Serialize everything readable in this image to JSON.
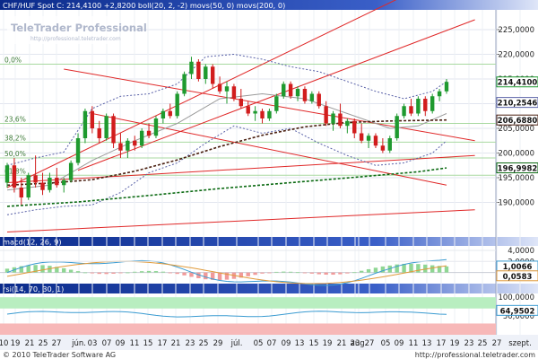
{
  "colors": {
    "up": "#1f9a2f",
    "down": "#d11d1d",
    "ma50": "#4a1f10",
    "ma200": "#0b6a12",
    "boll": "#5a62a8",
    "trend": "#e02828",
    "fib": "#a8d9a0",
    "macd_line": "#3a9bd1",
    "macd_signal": "#e09a3a",
    "rsi_line": "#3a9bd1",
    "rsi_over": "#f7b8b8",
    "rsi_under": "#b8eec0",
    "header_bg": "#0a2a8a",
    "sep": "#8aa0d8"
  },
  "chart_data": [
    {
      "type": "candlestick",
      "title": "CHF/HUF Spot C: 214,4100 +2,8200 boll(20, 2, -2) movs(50, 0) movs(200, 0)",
      "ylim": [
        183,
        229
      ],
      "yticks": [
        "225,0000",
        "220,0000",
        "215,0000",
        "210,0000",
        "205,0000",
        "200,0000",
        "195,0000",
        "190,0000"
      ],
      "fib_levels": [
        {
          "label": "0,0%",
          "value": 218.0
        },
        {
          "label": "23,6%",
          "value": 206.0
        },
        {
          "label": "38,2%",
          "value": 202.2
        },
        {
          "label": "50,0%",
          "value": 199.0
        },
        {
          "label": "61,8%",
          "value": 195.5
        }
      ],
      "price_tags": [
        {
          "text": "214,4100",
          "value": 214.41,
          "color": "#1f9a2f"
        },
        {
          "text": "210,2546",
          "value": 210.25,
          "color": "#5a62a8"
        },
        {
          "text": "206,6880",
          "value": 206.69,
          "color": "#4a1f10"
        },
        {
          "text": "196,9982",
          "value": 196.99,
          "color": "#0b6a12"
        }
      ],
      "candles": [
        [
          194.0,
          198.0,
          193.0,
          197.5
        ],
        [
          197.5,
          199.0,
          192.0,
          193.0
        ],
        [
          193.0,
          195.0,
          189.5,
          191.0
        ],
        [
          191.0,
          196.0,
          190.5,
          195.5
        ],
        [
          195.5,
          199.5,
          193.0,
          194.0
        ],
        [
          194.0,
          196.0,
          191.5,
          192.5
        ],
        [
          192.5,
          196.0,
          192.0,
          195.0
        ],
        [
          195.0,
          197.0,
          193.0,
          193.5
        ],
        [
          193.5,
          195.0,
          192.0,
          194.5
        ],
        [
          194.5,
          198.5,
          194.0,
          198.0
        ],
        [
          198.0,
          204.0,
          197.5,
          203.0
        ],
        [
          203.0,
          209.0,
          202.0,
          208.5
        ],
        [
          208.5,
          209.5,
          204.0,
          205.0
        ],
        [
          205.0,
          206.5,
          202.0,
          203.0
        ],
        [
          203.0,
          208.0,
          202.5,
          207.5
        ],
        [
          207.5,
          208.0,
          201.0,
          202.0
        ],
        [
          202.0,
          204.0,
          199.0,
          200.5
        ],
        [
          200.5,
          203.0,
          199.0,
          202.5
        ],
        [
          202.5,
          203.5,
          200.5,
          201.5
        ],
        [
          201.5,
          205.0,
          201.0,
          204.5
        ],
        [
          204.5,
          206.0,
          203.0,
          203.5
        ],
        [
          203.5,
          207.5,
          203.0,
          207.0
        ],
        [
          207.0,
          209.0,
          206.0,
          208.5
        ],
        [
          208.5,
          210.0,
          207.0,
          207.5
        ],
        [
          207.5,
          212.5,
          207.0,
          212.0
        ],
        [
          212.0,
          216.5,
          211.5,
          216.0
        ],
        [
          216.0,
          219.5,
          215.0,
          218.5
        ],
        [
          218.5,
          219.0,
          214.5,
          215.0
        ],
        [
          215.0,
          218.0,
          214.0,
          217.5
        ],
        [
          217.5,
          218.0,
          213.0,
          214.0
        ],
        [
          214.0,
          215.5,
          212.0,
          212.5
        ],
        [
          212.5,
          214.5,
          210.0,
          213.5
        ],
        [
          213.5,
          214.0,
          210.5,
          211.0
        ],
        [
          211.0,
          213.0,
          209.0,
          209.5
        ],
        [
          209.5,
          210.5,
          207.5,
          208.0
        ],
        [
          208.0,
          209.5,
          206.5,
          208.5
        ],
        [
          208.5,
          209.0,
          206.0,
          207.0
        ],
        [
          207.0,
          209.0,
          206.5,
          208.5
        ],
        [
          208.5,
          212.0,
          208.0,
          211.5
        ],
        [
          211.5,
          214.5,
          211.0,
          214.0
        ],
        [
          214.0,
          214.5,
          211.0,
          211.5
        ],
        [
          211.5,
          213.5,
          210.5,
          213.0
        ],
        [
          213.0,
          213.5,
          210.0,
          210.5
        ],
        [
          210.5,
          212.5,
          210.0,
          212.0
        ],
        [
          212.0,
          212.5,
          209.0,
          209.5
        ],
        [
          209.5,
          210.5,
          205.5,
          206.0
        ],
        [
          206.0,
          208.5,
          204.5,
          208.0
        ],
        [
          208.0,
          210.0,
          205.0,
          205.5
        ],
        [
          205.5,
          207.0,
          204.0,
          206.5
        ],
        [
          206.5,
          207.0,
          203.0,
          204.0
        ],
        [
          204.0,
          206.0,
          202.0,
          202.5
        ],
        [
          202.5,
          204.0,
          201.0,
          203.5
        ],
        [
          203.5,
          204.0,
          201.0,
          201.5
        ],
        [
          201.5,
          203.0,
          200.0,
          200.5
        ],
        [
          200.5,
          203.5,
          200.0,
          203.0
        ],
        [
          203.0,
          208.0,
          202.5,
          207.5
        ],
        [
          207.5,
          210.0,
          207.0,
          209.5
        ],
        [
          209.5,
          211.0,
          207.5,
          208.0
        ],
        [
          208.0,
          211.5,
          207.5,
          211.0
        ],
        [
          211.0,
          211.5,
          207.5,
          208.5
        ],
        [
          208.5,
          212.0,
          208.0,
          211.5
        ],
        [
          211.5,
          213.0,
          210.5,
          212.5
        ],
        [
          212.5,
          215.0,
          212.0,
          214.41
        ]
      ],
      "ma50": [
        [
          0,
          193.5
        ],
        [
          6,
          193.9
        ],
        [
          12,
          194.6
        ],
        [
          18,
          196.3
        ],
        [
          24,
          198.6
        ],
        [
          30,
          201.3
        ],
        [
          36,
          203.6
        ],
        [
          42,
          205.3
        ],
        [
          48,
          206.2
        ],
        [
          54,
          206.5
        ],
        [
          58,
          206.6
        ],
        [
          62,
          206.69
        ]
      ],
      "ma200": [
        [
          0,
          189.2
        ],
        [
          10,
          190.1
        ],
        [
          20,
          191.4
        ],
        [
          30,
          192.8
        ],
        [
          40,
          194.0
        ],
        [
          50,
          195.2
        ],
        [
          58,
          196.2
        ],
        [
          62,
          196.99
        ]
      ],
      "boll_upper": [
        [
          0,
          197.5
        ],
        [
          4,
          199.0
        ],
        [
          8,
          200.2
        ],
        [
          12,
          209.0
        ],
        [
          16,
          211.5
        ],
        [
          20,
          212.0
        ],
        [
          24,
          214.0
        ],
        [
          28,
          219.5
        ],
        [
          32,
          220.0
        ],
        [
          36,
          219.0
        ],
        [
          40,
          217.5
        ],
        [
          44,
          216.5
        ],
        [
          48,
          214.5
        ],
        [
          52,
          212.5
        ],
        [
          56,
          211.0
        ],
        [
          60,
          212.5
        ],
        [
          62,
          214.5
        ]
      ],
      "boll_lower": [
        [
          0,
          187.5
        ],
        [
          4,
          188.5
        ],
        [
          8,
          189.2
        ],
        [
          12,
          189.5
        ],
        [
          16,
          192.0
        ],
        [
          20,
          196.0
        ],
        [
          24,
          198.0
        ],
        [
          28,
          202.0
        ],
        [
          32,
          205.5
        ],
        [
          36,
          204.0
        ],
        [
          40,
          205.0
        ],
        [
          44,
          202.0
        ],
        [
          48,
          199.5
        ],
        [
          52,
          197.5
        ],
        [
          56,
          198.0
        ],
        [
          60,
          200.0
        ],
        [
          62,
          202.5
        ]
      ],
      "boll_mid": [
        [
          0,
          192.5
        ],
        [
          6,
          193.5
        ],
        [
          12,
          198.5
        ],
        [
          18,
          202.5
        ],
        [
          24,
          206.0
        ],
        [
          30,
          211.0
        ],
        [
          36,
          212.0
        ],
        [
          42,
          211.0
        ],
        [
          48,
          208.0
        ],
        [
          54,
          205.0
        ],
        [
          58,
          205.5
        ],
        [
          62,
          208.0
        ]
      ],
      "trendlines": [
        [
          [
            0,
            193.0
          ],
          [
            62,
            236.0
          ]
        ],
        [
          [
            10,
            196.5
          ],
          [
            66,
            227.0
          ]
        ],
        [
          [
            8,
            217.0
          ],
          [
            66,
            202.5
          ]
        ],
        [
          [
            12,
            208.0
          ],
          [
            62,
            193.5
          ]
        ],
        [
          [
            0,
            194.0
          ],
          [
            66,
            199.5
          ]
        ],
        [
          [
            0,
            184.0
          ],
          [
            66,
            188.5
          ]
        ]
      ]
    },
    {
      "type": "bar",
      "title": "macd(12, 26, 9)",
      "ylim": [
        -2,
        4.8
      ],
      "yticks": [
        "4,0000",
        "2,0000"
      ],
      "tags": [
        "1,0066",
        "0,0583"
      ]
    },
    {
      "type": "line",
      "title": "rsi(14, 70, 30, 1)",
      "ylim": [
        0,
        110
      ],
      "yticks": [
        "100,0000",
        "50,0000"
      ],
      "tags": [
        "64,9502"
      ]
    }
  ],
  "x_axis": [
    {
      "label": "10",
      "x": 4
    },
    {
      "label": "19",
      "x": 17
    },
    {
      "label": "21",
      "x": 33
    },
    {
      "label": "25",
      "x": 48
    },
    {
      "label": "27",
      "x": 63
    },
    {
      "label": "jún.",
      "x": 88
    },
    {
      "label": "03",
      "x": 103
    },
    {
      "label": "07",
      "x": 119
    },
    {
      "label": "09",
      "x": 134
    },
    {
      "label": "11",
      "x": 150
    },
    {
      "label": "15",
      "x": 165
    },
    {
      "label": "17",
      "x": 181
    },
    {
      "label": "21",
      "x": 196
    },
    {
      "label": "23",
      "x": 212
    },
    {
      "label": "25",
      "x": 227
    },
    {
      "label": "29",
      "x": 243
    },
    {
      "label": "júl.",
      "x": 264
    },
    {
      "label": "05",
      "x": 288
    },
    {
      "label": "07",
      "x": 303
    },
    {
      "label": "09",
      "x": 319
    },
    {
      "label": "13",
      "x": 334
    },
    {
      "label": "15",
      "x": 350
    },
    {
      "label": "19",
      "x": 365
    },
    {
      "label": "21",
      "x": 381
    },
    {
      "label": "23",
      "x": 396
    },
    {
      "label": "27",
      "x": 412
    },
    {
      "label": "aug.",
      "x": 400
    },
    {
      "label": "05",
      "x": 430
    },
    {
      "label": "09",
      "x": 445
    },
    {
      "label": "11",
      "x": 461
    },
    {
      "label": "13",
      "x": 476
    },
    {
      "label": "17",
      "x": 492
    },
    {
      "label": "19",
      "x": 507
    },
    {
      "label": "23",
      "x": 523
    },
    {
      "label": "25",
      "x": 538
    },
    {
      "label": "27",
      "x": 554
    },
    {
      "label": "szept.",
      "x": 580
    }
  ],
  "watermark": {
    "title": "TeleTrader Professional",
    "url": "http://professional.teletrader.com"
  },
  "footer": {
    "copyright": "© 2010 TeleTrader Software AG",
    "url": "http://professional.teletrader.com"
  }
}
